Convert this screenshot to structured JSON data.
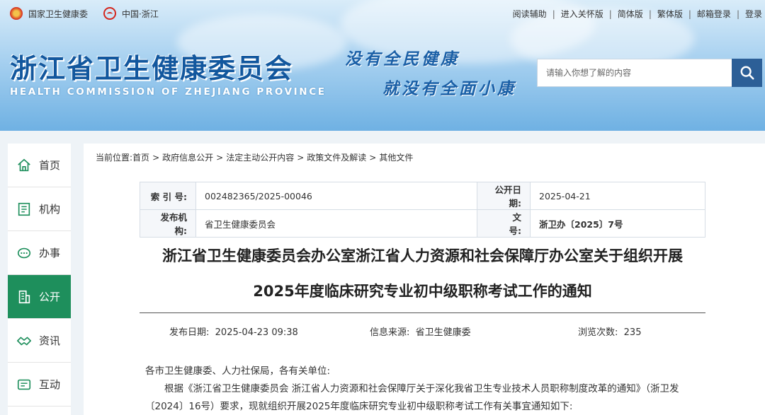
{
  "topbar": {
    "left_links": [
      "国家卫生健康委",
      "中国·浙江"
    ],
    "right_links": [
      "阅读辅助",
      "进入关怀版",
      "简体版",
      "繁体版",
      "邮箱登录",
      "登录"
    ]
  },
  "header": {
    "title": "浙江省卫生健康委员会",
    "subtitle": "HEALTH COMMISSION OF ZHEJIANG PROVINCE",
    "slogan_line1": "没有全民健康",
    "slogan_line2": "就没有全面小康"
  },
  "search": {
    "placeholder": "请输入你想了解的内容",
    "icon": "search-icon"
  },
  "sidenav": {
    "items": [
      {
        "label": "首页",
        "icon": "home-icon"
      },
      {
        "label": "机构",
        "icon": "org-icon"
      },
      {
        "label": "办事",
        "icon": "chat-icon"
      },
      {
        "label": "公开",
        "icon": "building-icon"
      },
      {
        "label": "资讯",
        "icon": "handshake-icon"
      },
      {
        "label": "互动",
        "icon": "message-icon"
      }
    ],
    "active_index": 3,
    "active_color": "#1e8f5c"
  },
  "breadcrumb": {
    "prefix": "当前位置:",
    "items": [
      "首页",
      "政府信息公开",
      "法定主动公开内容",
      "政策文件及解读",
      "其他文件"
    ]
  },
  "meta": {
    "index_label": "索 引 号:",
    "index_value": "002482365/2025-00046",
    "pubdate_label": "公开日期:",
    "pubdate_value": "2025-04-21",
    "issuer_label": "发布机构:",
    "issuer_value": "省卫生健康委员会",
    "docno_label": "文　　号:",
    "docno_value": "浙卫办〔2025〕7号"
  },
  "document": {
    "title_line1": "浙江省卫生健康委员会办公室浙江省人力资源和社会保障厅办公室关于组织开展",
    "title_line2": "2025年度临床研究专业初中级职称考试工作的通知",
    "publish_label": "发布日期:",
    "publish_value": "2025-04-23 09:38",
    "source_label": "信息来源:",
    "source_value": "省卫生健康委",
    "views_label": "浏览次数:",
    "views_value": "235",
    "salutation": "各市卫生健康委、人力社保局，各有关单位:",
    "para1": "根据《浙江省卫生健康委员会 浙江省人力资源和社会保障厅关于深化我省卫生专业技术人员职称制度改革的通知》（浙卫发〔2024〕16号）要求，现就组织开展2025年度临床研究专业初中级职称考试工作有关事宜通知如下:"
  }
}
